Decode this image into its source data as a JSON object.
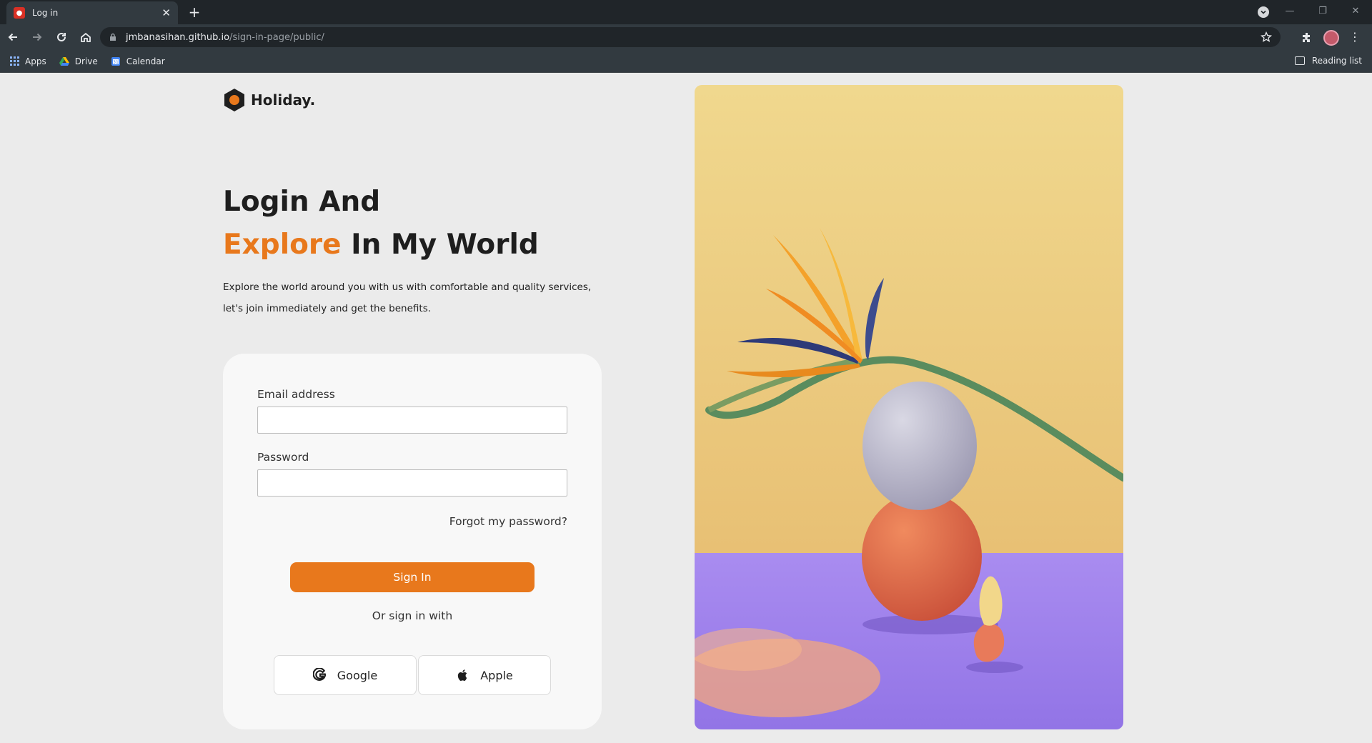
{
  "browser": {
    "tab_title": "Log in",
    "url_host": "jmbanasihan.github.io",
    "url_path": "/sign-in-page/public/",
    "bookmarks": [
      {
        "label": "Apps"
      },
      {
        "label": "Drive"
      },
      {
        "label": "Calendar"
      }
    ],
    "reading_list": "Reading list"
  },
  "brand": {
    "name": "Holiday.",
    "accent_color": "#e8781c"
  },
  "hero": {
    "line1": "Login And",
    "accent_word": "Explore",
    "line2_rest": " In My World",
    "subtitle_line1": "Explore the world around you with us with comfortable and quality services,",
    "subtitle_line2": "let's join immediately and get the benefits."
  },
  "login_form": {
    "email_label": "Email address",
    "email_value": "",
    "password_label": "Password",
    "password_value": "",
    "forgot_label": "Forgot my password?",
    "submit_label": "Sign In",
    "alt_label": "Or sign in with",
    "social": [
      {
        "label": "Google",
        "icon": "google-icon"
      },
      {
        "label": "Apple",
        "icon": "apple-icon"
      }
    ]
  },
  "image": {
    "icon": "bird-of-paradise-photo"
  }
}
